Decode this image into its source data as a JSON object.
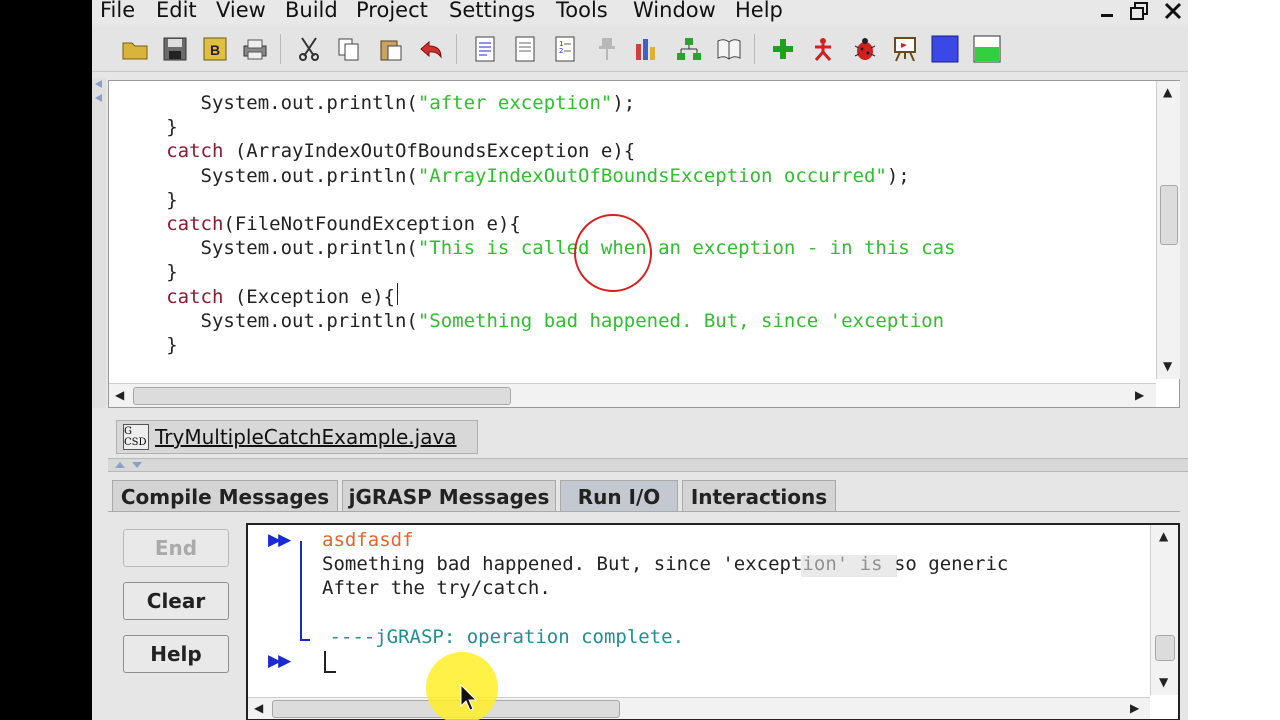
{
  "menu": {
    "items": [
      "File",
      "Edit",
      "View",
      "Build",
      "Project",
      "Settings",
      "Tools",
      "Window",
      "Help"
    ]
  },
  "toolbar": {
    "icons": [
      "open-folder-icon",
      "save-icon",
      "backup-icon",
      "print-icon",
      "cut-icon",
      "copy-icon",
      "paste-icon",
      "undo-icon",
      "document-icon",
      "document-lines-icon",
      "document-numbers-icon",
      "pin-icon",
      "chart-icon",
      "hierarchy-icon",
      "book-icon",
      "plus-icon",
      "run-figure-icon",
      "debug-bug-icon",
      "easel-icon",
      "blue-square-icon",
      "green-square-icon"
    ]
  },
  "editor": {
    "lines": [
      [
        {
          "t": "        System.out.println(",
          "c": "p"
        },
        {
          "t": "\"after exception\"",
          "c": "s"
        },
        {
          "t": ");",
          "c": "p"
        }
      ],
      [
        {
          "t": "     }",
          "c": "p"
        }
      ],
      [
        {
          "t": "     ",
          "c": "p"
        },
        {
          "t": "catch",
          "c": "k"
        },
        {
          "t": " (ArrayIndexOutOfBoundsException e){",
          "c": "p"
        }
      ],
      [
        {
          "t": "        System.out.println(",
          "c": "p"
        },
        {
          "t": "\"ArrayIndexOutOfBoundsException occurred\"",
          "c": "s"
        },
        {
          "t": ");",
          "c": "p"
        }
      ],
      [
        {
          "t": "     }",
          "c": "p"
        }
      ],
      [
        {
          "t": "     ",
          "c": "p"
        },
        {
          "t": "catch",
          "c": "k"
        },
        {
          "t": "(FileNotFoundException e){",
          "c": "p"
        }
      ],
      [
        {
          "t": "        System.out.println(",
          "c": "p"
        },
        {
          "t": "\"This is called when an exception - in this cas",
          "c": "s"
        }
      ],
      [
        {
          "t": "     }",
          "c": "p"
        }
      ],
      [
        {
          "t": "     ",
          "c": "p"
        },
        {
          "t": "catch",
          "c": "k"
        },
        {
          "t": " (Exception e){",
          "c": "p"
        }
      ],
      [
        {
          "t": "        System.out.println(",
          "c": "p"
        },
        {
          "t": "\"Something bad happened. But, since 'exception",
          "c": "s"
        }
      ],
      [
        {
          "t": "     }",
          "c": "p"
        }
      ]
    ]
  },
  "file_tab": {
    "icon_text": "G CSD",
    "label": "TryMultipleCatchExample.java"
  },
  "message_tabs": [
    "Compile Messages",
    "jGRASP Messages",
    "Run I/O",
    "Interactions"
  ],
  "run_buttons": {
    "end": "End",
    "clear": "Clear",
    "help": "Help"
  },
  "console": {
    "prompt": "▶▶",
    "input_line": "asdfasdf",
    "output_line1": "Something bad happened. But, since 'exception' is so generic",
    "output_line2": "After the try/catch.",
    "complete_line": " ----jGRASP: operation complete."
  },
  "colors": {
    "keyword": "#8b1b2e",
    "string": "#2fbf2f",
    "prompt": "#1a2bd6",
    "input": "#e0662a",
    "complete": "#1f8f8f",
    "annotation_circle": "#d92020"
  }
}
